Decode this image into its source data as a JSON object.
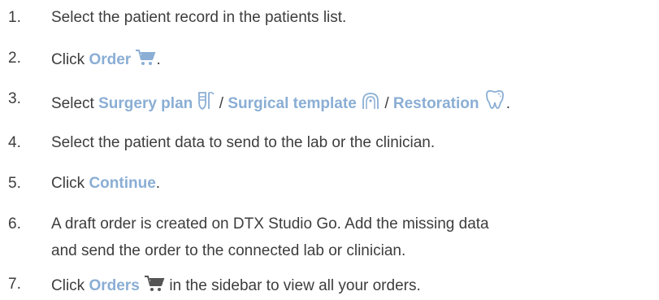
{
  "steps": [
    {
      "num": "1.",
      "text": "Select the patient record in the patients list."
    },
    {
      "num": "2.",
      "pre": "Click ",
      "ui": "Order",
      "post": ".",
      "icon": "shopping-cart-icon"
    },
    {
      "num": "3.",
      "pre": "Select ",
      "ui1": "Surgery plan",
      "sep1": " / ",
      "ui2": "Surgical template",
      "sep2": " / ",
      "ui3": "Restoration",
      "post": ".",
      "icons": [
        "implant-icon",
        "surgical-guide-icon",
        "tooth-icon"
      ]
    },
    {
      "num": "4.",
      "text": "Select the patient data to send to the lab or the clinician."
    },
    {
      "num": "5.",
      "pre": "Click ",
      "ui": "Continue",
      "post": "."
    },
    {
      "num": "6.",
      "line1": "A draft order is created on DTX Studio Go. Add the missing data",
      "line2": "and send the order to the connected lab or clinician."
    },
    {
      "num": "7.",
      "pre": "Click ",
      "ui": "Orders",
      "post": " in the sidebar to view all your orders.",
      "icon": "shopping-cart-icon"
    }
  ],
  "colors": {
    "text": "#3d3d3d",
    "ui_label": "#8aaed4"
  }
}
